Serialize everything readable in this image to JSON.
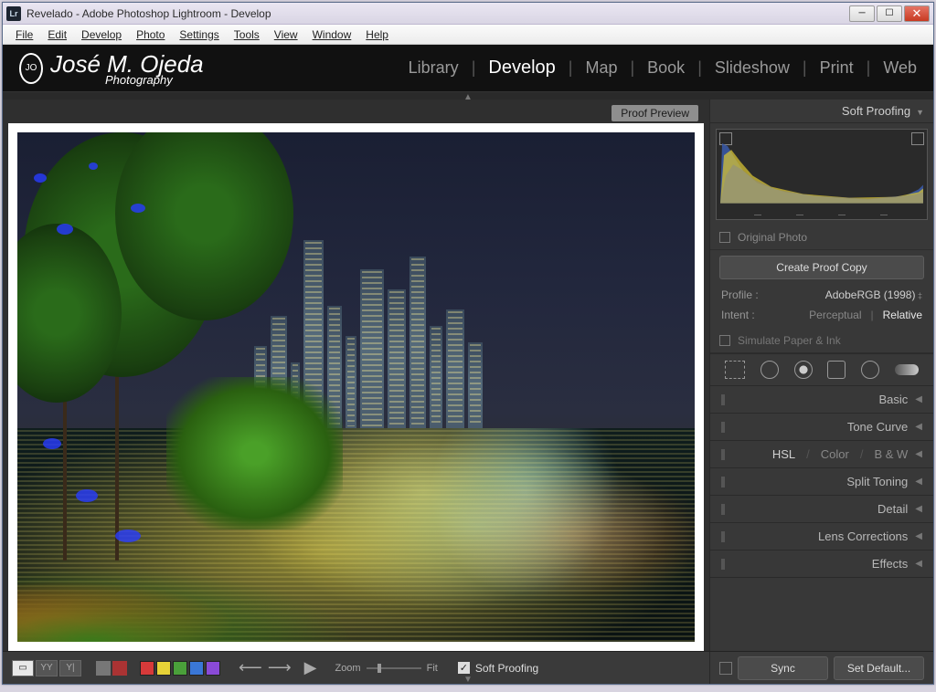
{
  "window": {
    "title": "Revelado - Adobe Photoshop Lightroom - Develop",
    "icon_text": "Lr"
  },
  "menubar": [
    "File",
    "Edit",
    "Develop",
    "Photo",
    "Settings",
    "Tools",
    "View",
    "Window",
    "Help"
  ],
  "identity": {
    "name": "José M. Ojeda",
    "sub": "Photography"
  },
  "modules": {
    "items": [
      "Library",
      "Develop",
      "Map",
      "Book",
      "Slideshow",
      "Print",
      "Web"
    ],
    "active": "Develop"
  },
  "preview": {
    "proof_badge": "Proof Preview"
  },
  "right_panel": {
    "header": "Soft Proofing",
    "original_photo": "Original Photo",
    "create_copy": "Create Proof Copy",
    "profile_lbl": "Profile :",
    "profile_val": "AdobeRGB (1998)",
    "intent_lbl": "Intent :",
    "intent_opts": [
      "Perceptual",
      "Relative"
    ],
    "simulate": "Simulate Paper & Ink",
    "sections": [
      "Basic",
      "Tone Curve",
      "Split Toning",
      "Detail",
      "Lens Corrections",
      "Effects"
    ],
    "hsl_row": {
      "hsl": "HSL",
      "color": "Color",
      "bw": "B & W"
    }
  },
  "bottom": {
    "zoom_lbl": "Zoom",
    "fit_lbl": "Fit",
    "soft_proof_lbl": "Soft Proofing",
    "sync": "Sync",
    "set_default": "Set Default...",
    "color_labels": [
      "#d73a3a",
      "#e7d237",
      "#4aa03a",
      "#3a77d7",
      "#8a4ad7"
    ]
  }
}
